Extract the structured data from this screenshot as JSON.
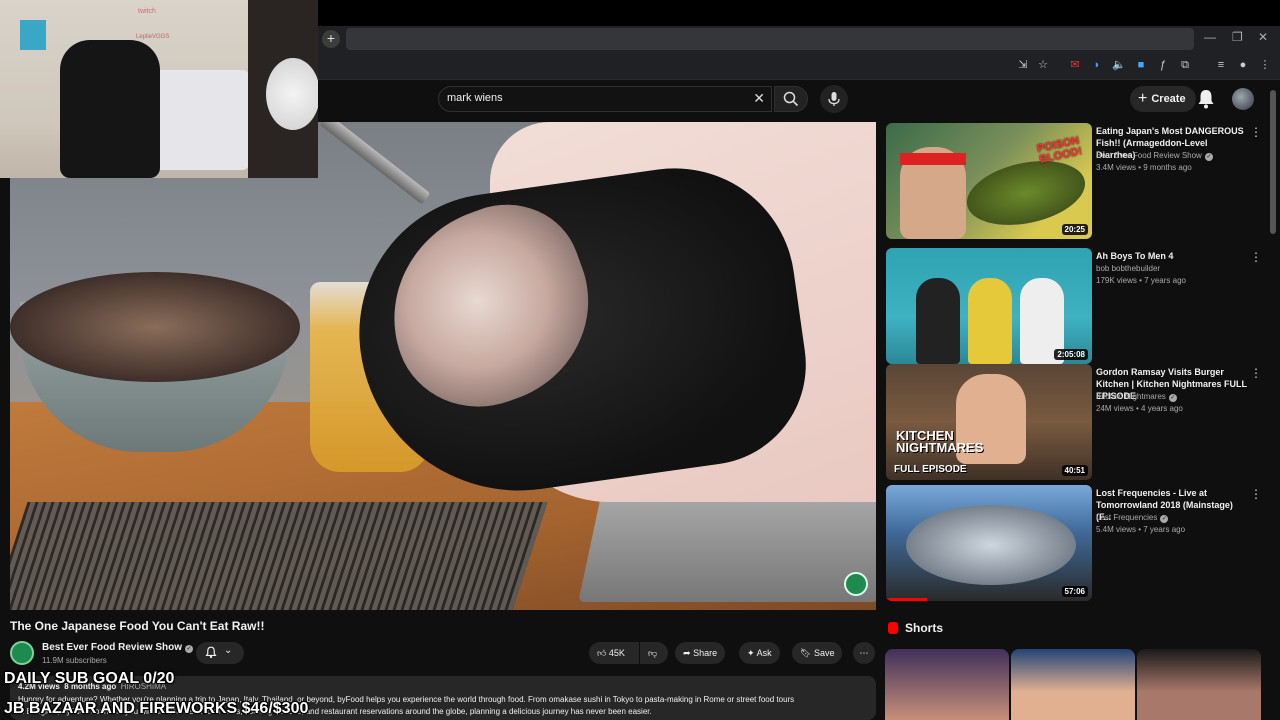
{
  "search": {
    "query": "mark wiens"
  },
  "header": {
    "create_label": "Create"
  },
  "webcam": {
    "sign_text": "LeplieVGGS",
    "sign_sub": "twitch"
  },
  "video": {
    "title": "The One Japanese Food You Can't Eat Raw!!",
    "channel": "Best Ever Food Review Show",
    "subscribers": "11.9M subscribers",
    "likes": "45K",
    "share_label": "Share",
    "ask_label": "Ask",
    "save_label": "Save",
    "views": "4.2M views",
    "age": "8 months ago",
    "tag": "HIROSHIMA",
    "description_line1": "Hungry for adventure? Whether you're planning a trip to Japan, Italy, Thailand, or beyond, byFood helps you experience the world through food. From omakase sushi in Tokyo to pasta-making in Rome or street food tours",
    "description_line2": "in Bangkok, byFood connects you with thousands of food tours, cooking classes, and restaurant reservations around the globe, planning a delicious journey has never been easier."
  },
  "overlay": {
    "sub_goal": "DAILY SUB GOAL 0/20",
    "bazaar": "JB BAZAAR AND FIREWORKS $46/$300"
  },
  "recommendations": [
    {
      "title": "Eating Japan's Most DANGEROUS Fish!! (Armageddon-Level Diarrhea)",
      "channel": "Best Ever Food Review Show",
      "verified": true,
      "meta": "3.4M views • 9 months ago",
      "duration": "20:25",
      "thumb_text": "POISON BLOOD!"
    },
    {
      "title": "Ah Boys To Men 4",
      "channel": "bob bobthebuilder",
      "verified": false,
      "meta": "179K views • 7 years ago",
      "duration": "2:05:08"
    },
    {
      "title": "Gordon Ramsay Visits Burger Kitchen | Kitchen Nightmares FULL EPISODE",
      "channel": "Kitchen Nightmares",
      "verified": true,
      "meta": "24M views • 4 years ago",
      "duration": "40:51",
      "thumb_text": "KITCHEN NIGHTMARES",
      "thumb_text2": "FULL EPISODE"
    },
    {
      "title": "Lost Frequencies - Live at Tomorrowland 2018 (Mainstage) (F...",
      "channel": "Lost Frequencies",
      "verified": true,
      "meta": "5.4M views • 7 years ago",
      "duration": "57:06",
      "progress": 0.2
    }
  ],
  "shorts": {
    "label": "Shorts"
  },
  "colors": {
    "accent": "#ff0000",
    "background": "#0f0f0f",
    "surface": "#272727"
  }
}
